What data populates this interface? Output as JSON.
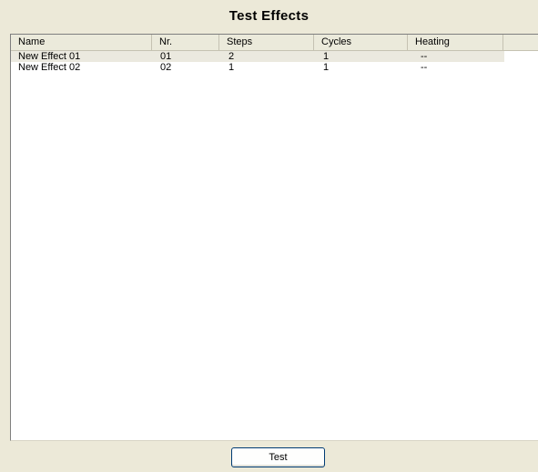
{
  "window": {
    "title": "Test Effects"
  },
  "effects_list": {
    "columns": [
      {
        "key": "name",
        "label": "Name"
      },
      {
        "key": "nr",
        "label": "Nr."
      },
      {
        "key": "steps",
        "label": "Steps"
      },
      {
        "key": "cycles",
        "label": "Cycles"
      },
      {
        "key": "heating",
        "label": "Heating"
      }
    ],
    "rows": [
      {
        "name": "New Effect 01",
        "nr": "01",
        "steps": "2",
        "cycles": "1",
        "heating": "--",
        "selected": true
      },
      {
        "name": "New Effect 02",
        "nr": "02",
        "steps": "1",
        "cycles": "1",
        "heating": "--",
        "selected": false
      }
    ]
  },
  "actions": {
    "test_label": "Test"
  },
  "colors": {
    "window_background": "#ece9d8",
    "list_background": "#ffffff",
    "selected_row": "#ebe9df",
    "button_border": "#003c74"
  }
}
